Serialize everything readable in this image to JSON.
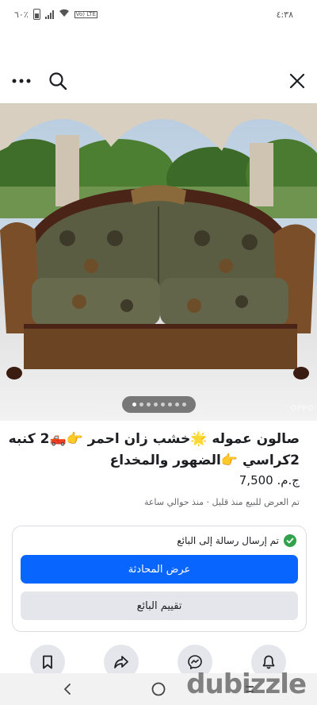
{
  "status_bar": {
    "battery": "٦٠٪",
    "network_badge": "Vo) LTE",
    "time": "٤:٣٨"
  },
  "top_bar": {
    "icons": [
      "more-icon",
      "search-icon",
      "close-icon"
    ]
  },
  "listing": {
    "image_watermark": "OPPO",
    "image_pager": {
      "total": 8,
      "active_index": 0
    },
    "title": "صالون عموله 🌟خشب زان احمر  👉🛻2 كنبه 2كراسي  👉الضهور والمخداع",
    "price": "ج.م. 7,500",
    "meta": "تم العرض للبيع منذ قليل · منذ حوالي ساعة"
  },
  "message_card": {
    "sent_notice": "تم إرسال رسالة إلى البائع",
    "view_conversation": "عرض المحادثة",
    "rate_seller": "تقييم البائع"
  },
  "action_bar": {
    "icons": [
      "bookmark-icon",
      "share-icon",
      "messenger-icon",
      "bell-icon"
    ]
  },
  "brand": "dubizzle",
  "colors": {
    "primary": "#0866ff",
    "secondary_button": "#e4e6eb",
    "success": "#31a24c",
    "text": "#1c1e21",
    "muted_text": "#65676b"
  }
}
